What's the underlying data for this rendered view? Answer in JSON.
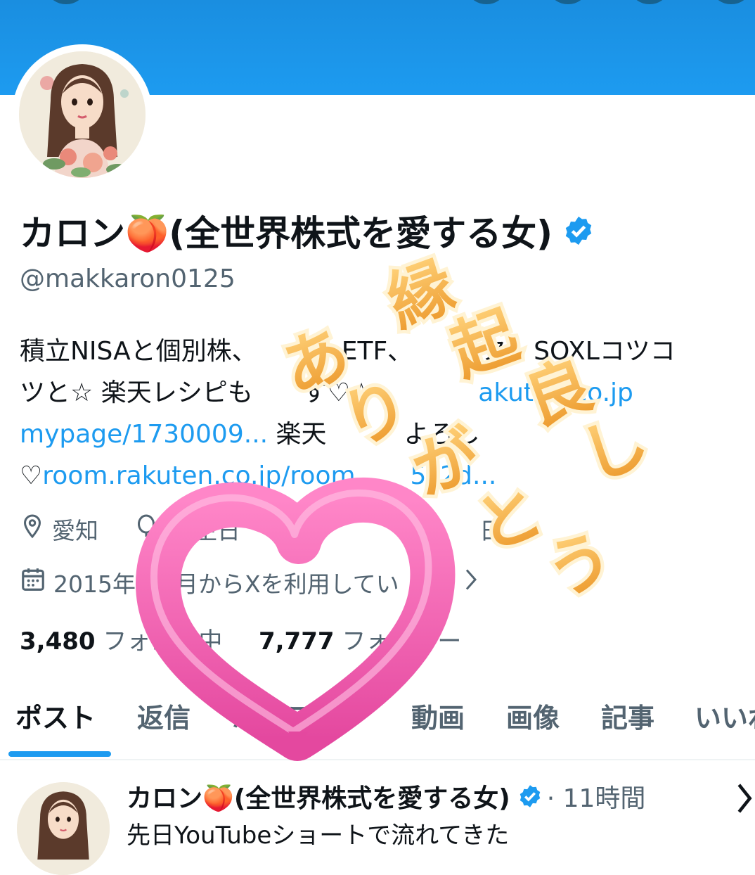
{
  "profile": {
    "name": "カロン🍑(全世界株式を愛する女)",
    "handle": "@makkaron0125",
    "bio_line1": "積立NISAと個別株、",
    "bio_line1b": "ETF、",
    "bio_line1c": "ス、SOXLコツコ",
    "bio_line2": "ツと☆ 楽天レシピも",
    "bio_line2b": "す♡☆",
    "bio_link1": "akuten.co.jp",
    "bio_link2": "mypage/1730009...",
    "bio_line3": " 楽天",
    "bio_line3b": "よろし",
    "bio_line4_prefix": "♡",
    "bio_link3": "room.rakuten.co.jp/room_",
    "bio_link3b": "5c2d...",
    "location": "愛知",
    "birthday": "生日",
    "birthday_tail": "日",
    "joined": "2015年",
    "joined_tail": "月からXを利用してい"
  },
  "counts": {
    "following_value": "3,480",
    "following_label": "フォロー中",
    "followers_value": "7,777",
    "followers_label": "フォロワー"
  },
  "tabs": [
    {
      "label": "ポスト"
    },
    {
      "label": "返信"
    },
    {
      "label": "ハイライト"
    },
    {
      "label": "動画"
    },
    {
      "label": "画像"
    },
    {
      "label": "記事"
    },
    {
      "label": "いいね"
    }
  ],
  "post": {
    "author": "カロン🍑(全世界株式を愛する女)",
    "time": "· 11時間",
    "text": "先日YouTubeショートで流れてきた"
  },
  "sticker": {
    "chars": [
      "縁",
      "起",
      "良",
      "し",
      "あ",
      "り",
      "が",
      "と",
      "う"
    ]
  },
  "colors": {
    "banner": "#1d9bf0",
    "link": "#1d9bf0",
    "verified": "#1d9bf0",
    "heart": "#f06bb7",
    "sticker_fill": "#f4ad38"
  },
  "icons": [
    "location-icon",
    "balloon-icon",
    "calendar-icon",
    "verified-badge-icon",
    "chevron-right-icon"
  ]
}
